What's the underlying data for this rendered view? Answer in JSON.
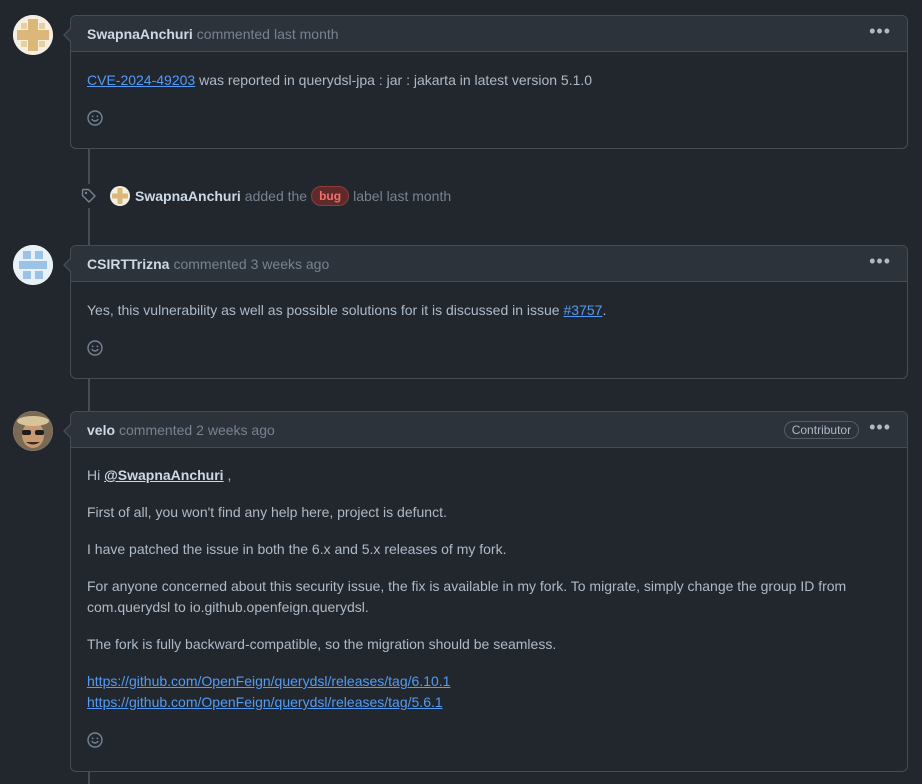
{
  "comments": [
    {
      "author": "SwapnaAnchuri",
      "action": "commented",
      "time": "last month",
      "body_link": "CVE-2024-49203",
      "body_text": " was reported in querydsl-jpa : jar : jakarta in latest version 5.1.0",
      "avatar_icon": "swapna-avatar-icon"
    },
    {
      "author": "CSIRTTrizna",
      "action": "commented",
      "time": "3 weeks ago",
      "body_text": "Yes, this vulnerability as well as possible solutions for it is discussed in issue ",
      "body_link": "#3757",
      "body_tail": ".",
      "avatar_icon": "csirt-avatar-icon"
    },
    {
      "author": "velo",
      "action": "commented",
      "time": "2 weeks ago",
      "badge": "Contributor",
      "greeting": "Hi ",
      "mention": "@SwapnaAnchuri",
      "greeting_tail": " ,",
      "paragraphs": [
        "First of all, you won't find any help here, project is defunct.",
        "I have patched the issue in both the 6.x and 5.x releases of my fork.",
        "For anyone concerned about this security issue, the fix is available in my fork. To migrate, simply change the group ID from com.querydsl to io.github.openfeign.querydsl.",
        "The fork is fully backward-compatible, so the migration should be seamless."
      ],
      "links": [
        "https://github.com/OpenFeign/querydsl/releases/tag/6.10.1",
        "https://github.com/OpenFeign/querydsl/releases/tag/5.6.1"
      ],
      "avatar_icon": "velo-avatar-icon"
    }
  ],
  "label_event": {
    "actor": "SwapnaAnchuri",
    "before": "added the",
    "label": "bug",
    "after": "label last month",
    "icon": "tag-icon"
  },
  "kebab": "•••",
  "colors": {
    "background": "#22272e",
    "header": "#2d333b",
    "border": "#444c56",
    "link": "#539bf5",
    "bug_label": "#f47067"
  }
}
